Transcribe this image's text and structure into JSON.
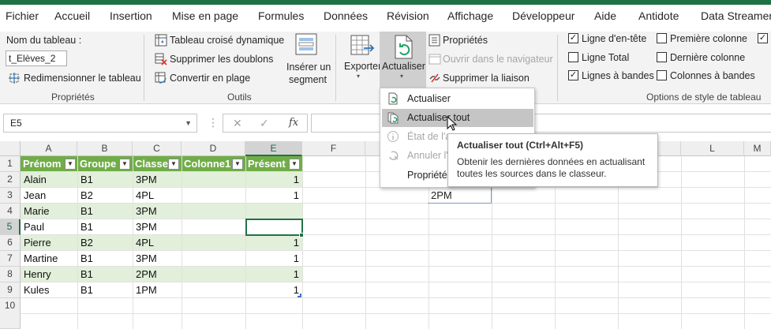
{
  "tabs": [
    "Fichier",
    "Accueil",
    "Insertion",
    "Mise en page",
    "Formules",
    "Données",
    "Révision",
    "Affichage",
    "Développeur",
    "Aide",
    "Antidote",
    "Data Streamer"
  ],
  "ribbon": {
    "props_group": {
      "table_name_label": "Nom du tableau :",
      "table_name_value": "t_Elèves_2",
      "resize_label": "Redimensionner le tableau",
      "group_label": "Propriétés"
    },
    "tools_group": {
      "pivot_label": "Tableau croisé dynamique",
      "dedupe_label": "Supprimer les doublons",
      "convert_label": "Convertir en plage",
      "slicer_line1": "Insérer un",
      "slicer_line2": "segment",
      "group_label": "Outils"
    },
    "external_group": {
      "export_label": "Exporter",
      "refresh_label": "Actualiser",
      "properties_label": "Propriétés",
      "open_browser_label": "Ouvrir dans le navigateur",
      "unlink_label": "Supprimer la liaison"
    },
    "style_options": {
      "header_row": {
        "label": "Ligne d'en-tête",
        "checked": true
      },
      "total_row": {
        "label": "Ligne Total",
        "checked": false
      },
      "banded_rows": {
        "label": "Lignes à bandes",
        "checked": true
      },
      "first_column": {
        "label": "Première colonne",
        "checked": false
      },
      "last_column": {
        "label": "Dernière colonne",
        "checked": false
      },
      "banded_columns": {
        "label": "Colonnes à bandes",
        "checked": false
      },
      "group_label": "Options de style de tableau"
    }
  },
  "formula_bar": {
    "name_box": "E5",
    "cancel_symbol": "✕",
    "enter_symbol": "✓",
    "fx_symbol": "fx",
    "formula": ""
  },
  "grid": {
    "columns": [
      "A",
      "B",
      "C",
      "D",
      "E",
      "F",
      "G",
      "H",
      "I",
      "J",
      "K",
      "L",
      "M"
    ],
    "rows": [
      "1",
      "2",
      "3",
      "4",
      "5",
      "6",
      "7",
      "8",
      "9",
      "10"
    ],
    "selected_cell": "E5",
    "table_headers": [
      "Prénom",
      "Groupe",
      "Classe",
      "Colonne1",
      "Présent"
    ],
    "table_rows": [
      {
        "prenom": "Alain",
        "groupe": "B1",
        "classe": "3PM",
        "col1": "",
        "present": "1"
      },
      {
        "prenom": "Jean",
        "groupe": "B2",
        "classe": "4PL",
        "col1": "",
        "present": "1"
      },
      {
        "prenom": "Marie",
        "groupe": "B1",
        "classe": "3PM",
        "col1": "",
        "present": ""
      },
      {
        "prenom": "Paul",
        "groupe": "B1",
        "classe": "3PM",
        "col1": "",
        "present": ""
      },
      {
        "prenom": "Pierre",
        "groupe": "B2",
        "classe": "4PL",
        "col1": "",
        "present": "1"
      },
      {
        "prenom": "Martine",
        "groupe": "B1",
        "classe": "3PM",
        "col1": "",
        "present": "1"
      },
      {
        "prenom": "Henry",
        "groupe": "B1",
        "classe": "2PM",
        "col1": "",
        "present": "1"
      },
      {
        "prenom": "Kules",
        "groupe": "B1",
        "classe": "1PM",
        "col1": "",
        "present": "1"
      }
    ],
    "cell_I3": "2PM"
  },
  "refresh_menu": {
    "items": [
      {
        "label": "Actualiser",
        "disabled": false
      },
      {
        "label": "Actualiser tout",
        "disabled": false,
        "hover": true
      },
      {
        "label": "État de l'a",
        "disabled": true
      },
      {
        "label": "Annuler l'",
        "disabled": true
      },
      {
        "label": "Propriétés",
        "disabled": false
      }
    ]
  },
  "tooltip": {
    "title": "Actualiser tout (Ctrl+Alt+F5)",
    "description": "Obtenir les dernières données en actualisant toutes les sources dans le classeur."
  },
  "colors": {
    "excel_green": "#217346",
    "table_header": "#70ad47",
    "table_band": "#e2efda"
  }
}
